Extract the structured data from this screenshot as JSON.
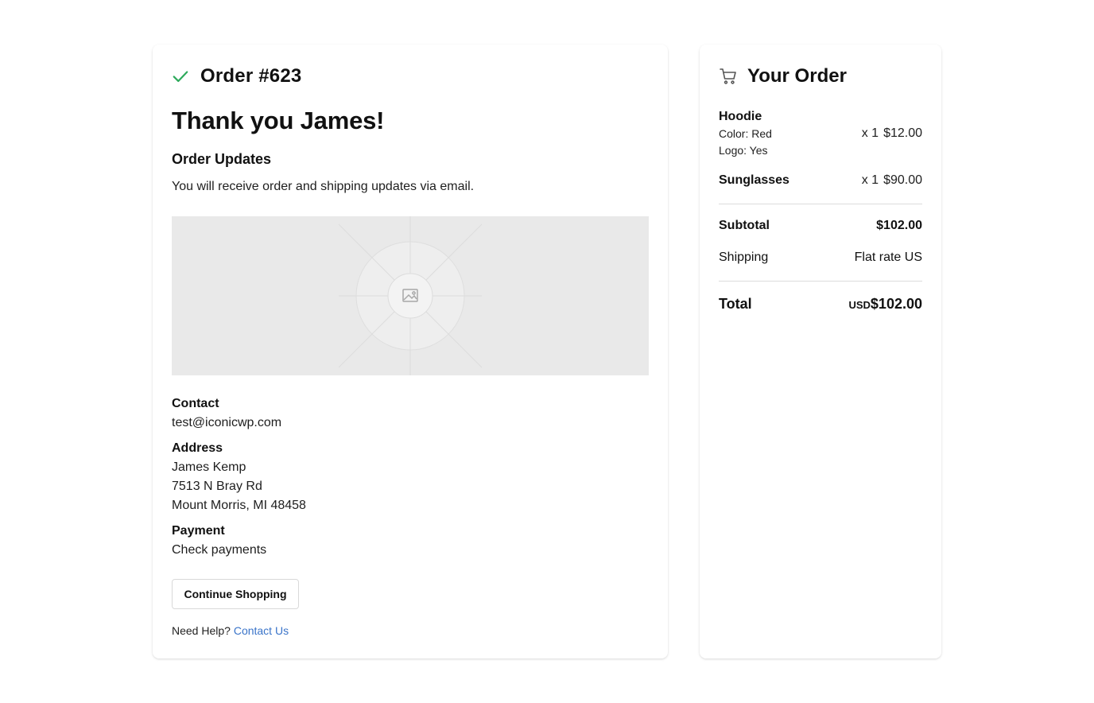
{
  "order": {
    "title": "Order #623",
    "thank_you": "Thank you James!",
    "updates_heading": "Order Updates",
    "updates_text": "You will receive order and shipping updates via email."
  },
  "contact": {
    "label": "Contact",
    "email": "test@iconicwp.com"
  },
  "address": {
    "label": "Address",
    "name": "James Kemp",
    "street": "7513 N Bray Rd",
    "city": "Mount Morris, MI 48458"
  },
  "payment": {
    "label": "Payment",
    "method": "Check payments"
  },
  "actions": {
    "continue_label": "Continue Shopping",
    "help_text": "Need Help?",
    "contact_link": "Contact Us"
  },
  "summary": {
    "title": "Your Order",
    "items": [
      {
        "name": "Hoodie",
        "options": [
          "Color: Red",
          "Logo: Yes"
        ],
        "qty": "x 1",
        "price": "$12.00"
      },
      {
        "name": "Sunglasses",
        "options": [],
        "qty": "x 1",
        "price": "$90.00"
      }
    ],
    "subtotal_label": "Subtotal",
    "subtotal_value": "$102.00",
    "shipping_label": "Shipping",
    "shipping_value": "Flat rate US",
    "total_label": "Total",
    "total_currency": "USD",
    "total_value": "$102.00"
  },
  "icons": {
    "order_status": "checkmark-icon",
    "cart": "cart-icon",
    "image_placeholder": "image-icon"
  },
  "colors": {
    "check": "#2eaa5c",
    "link": "#3a74c9",
    "placeholder_bg": "#e9e9e9"
  }
}
